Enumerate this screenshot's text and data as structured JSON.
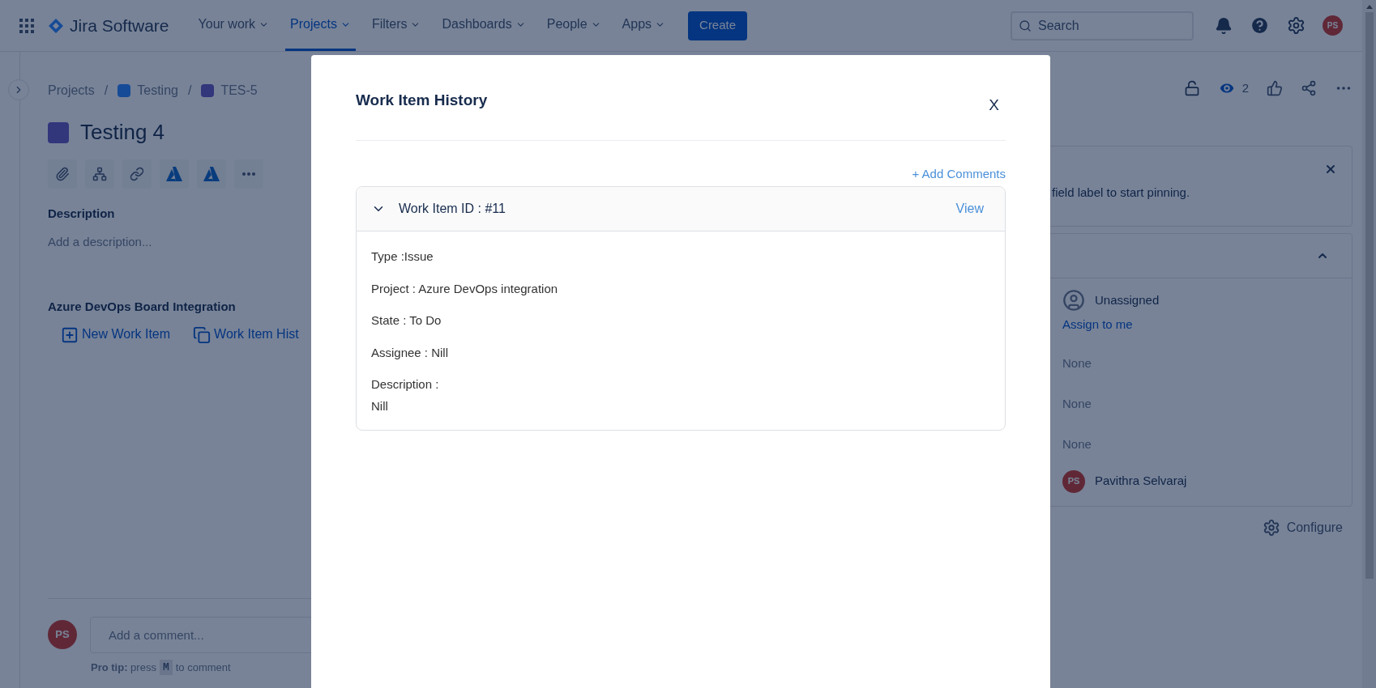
{
  "nav": {
    "product": "Jira Software",
    "items": [
      {
        "label": "Your work",
        "selected": false
      },
      {
        "label": "Projects",
        "selected": true
      },
      {
        "label": "Filters",
        "selected": false
      },
      {
        "label": "Dashboards",
        "selected": false
      },
      {
        "label": "People",
        "selected": false
      },
      {
        "label": "Apps",
        "selected": false
      }
    ],
    "create": "Create",
    "search_placeholder": "Search",
    "avatar": "PS"
  },
  "breadcrumbs": [
    {
      "kind": "link",
      "label": "Projects"
    },
    {
      "kind": "separator",
      "label": "/"
    },
    {
      "kind": "project",
      "label": "Testing"
    },
    {
      "kind": "separator",
      "label": "/"
    },
    {
      "kind": "issue",
      "label": "TES-5"
    }
  ],
  "title": "Testing 4",
  "description": {
    "label": "Description",
    "placeholder": "Add a description..."
  },
  "integration": {
    "title": "Azure DevOps Board Integration",
    "links": [
      {
        "kind": "new",
        "label": "New Work Item"
      },
      {
        "kind": "history",
        "label": "Work Item Hist"
      }
    ]
  },
  "comment": {
    "avatar": "PS",
    "placeholder": "Add a comment...",
    "tip": "**Pro tip:** press",
    "key": "M",
    "tip_end": "to comment"
  },
  "actions": {
    "watchers": "2"
  },
  "pinned": {
    "text": "field label to start pinning."
  },
  "details": [
    {
      "kind": "user",
      "text": "Unassigned"
    },
    {
      "kind": "link",
      "text": "Assign to me"
    },
    {
      "kind": "text",
      "text": "None"
    },
    {
      "kind": "text",
      "text": "None"
    },
    {
      "kind": "text",
      "text": "None"
    },
    {
      "kind": "avatar",
      "initials": "PS",
      "text": "Pavithra Selvaraj"
    }
  ],
  "configure": "Configure",
  "modal": {
    "title": "Work Item History",
    "close": "X",
    "add_comments": "+ Add Comments",
    "item": {
      "header": "Work Item ID : #11",
      "expanded": true,
      "view": "View",
      "fields": [
        "Type :Issue",
        "Project : Azure DevOps integration",
        "State : To Do",
        "Assignee : Nill"
      ],
      "description_label": "Description :",
      "description_value": "Nill"
    }
  }
}
